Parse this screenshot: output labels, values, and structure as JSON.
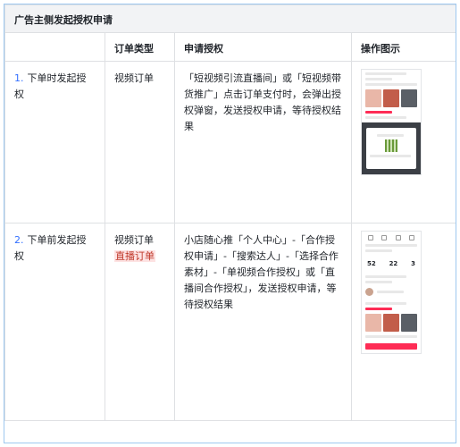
{
  "section_title": "广告主侧发起授权申请",
  "headers": {
    "col_order_type": "订单类型",
    "col_apply": "申请授权",
    "col_figure": "操作图示"
  },
  "rows": [
    {
      "index": "1.",
      "scenario": "下单时发起授权",
      "order_type": "视频订单",
      "description": "「短视频引流直播间」或「短视频带货推广」点击订单支付时，会弹出授权弹窗，发送授权申请，等待授权结果"
    },
    {
      "index": "2.",
      "scenario": "下单前发起授权",
      "order_type_1": "视频订单",
      "order_type_2": "直播订单",
      "description": "小店随心推「个人中心」-「合作授权申请」-「搜索达人」-「选择合作素材」-「单视频合作授权」或「直播间合作授权」，发送授权申请，等待授权结果"
    }
  ],
  "mock2_stats": [
    "52",
    "22",
    "3"
  ],
  "colors": {
    "accent_number": "#3370ff",
    "highlight_bg": "#fde2e2",
    "highlight_text": "#c0392b",
    "brand_red": "#fe2c55"
  }
}
